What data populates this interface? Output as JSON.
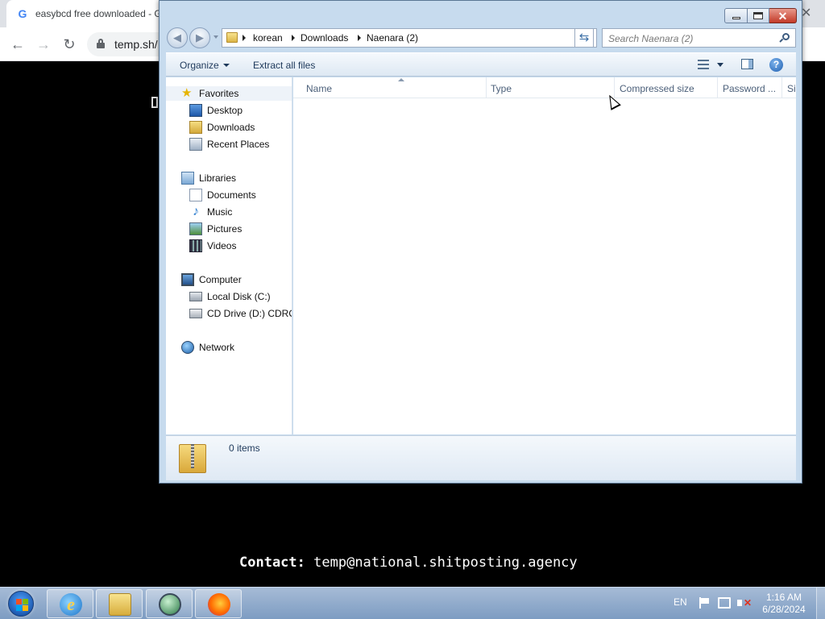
{
  "browser": {
    "tab_title": "easybcd free downloaded - G",
    "url": "temp.sh/"
  },
  "page": {
    "contact_label": "Contact:",
    "contact_email": "temp@national.shitposting.agency"
  },
  "explorer": {
    "breadcrumb": [
      "korean",
      "Downloads",
      "Naenara (2)"
    ],
    "search_placeholder": "Search Naenara (2)",
    "toolbar": {
      "organize": "Organize",
      "extract_all": "Extract all files"
    },
    "nav": {
      "favorites": "Favorites",
      "desktop": "Desktop",
      "downloads": "Downloads",
      "recent_places": "Recent Places",
      "libraries": "Libraries",
      "documents": "Documents",
      "music": "Music",
      "pictures": "Pictures",
      "videos": "Videos",
      "computer": "Computer",
      "local_disk": "Local Disk (C:)",
      "cd_drive": "CD Drive (D:) CDROM",
      "network": "Network"
    },
    "columns": [
      "Name",
      "Type",
      "Compressed size",
      "Password ...",
      "Si"
    ],
    "status_text": "0 items"
  },
  "taskbar": {
    "language": "EN",
    "time": "1:16 AM",
    "date": "6/28/2024"
  }
}
